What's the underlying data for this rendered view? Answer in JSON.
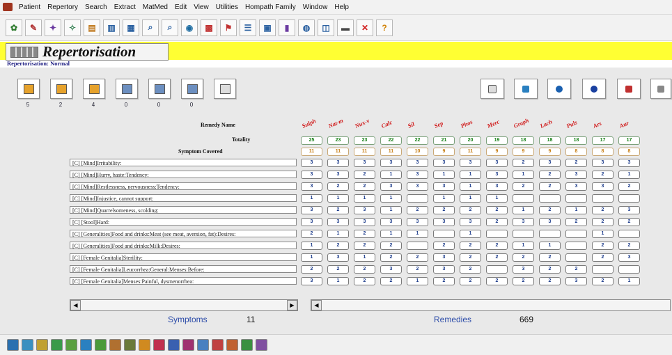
{
  "menu": [
    "Patient",
    "Repertory",
    "Search",
    "Extract",
    "MatMed",
    "Edit",
    "View",
    "Utilities",
    "Hompath Family",
    "Window",
    "Help"
  ],
  "title": "Repertorisation",
  "subtitle": "Repertorisation: Normal",
  "tool_counts": [
    "5",
    "2",
    "4",
    "0",
    "0",
    "0"
  ],
  "table": {
    "remedy_name_label": "Remedy Name",
    "totality_label": "Totality",
    "symptom_covered_label": "Symptom Covered",
    "remedies": [
      "Sulph",
      "Nat-m",
      "Nux-v",
      "Calc",
      "Sil",
      "Sep",
      "Phos",
      "Merc",
      "Graph",
      "Lach",
      "Puls",
      "Ars",
      "Aur"
    ],
    "totality": [
      "25",
      "23",
      "23",
      "22",
      "22",
      "21",
      "20",
      "19",
      "18",
      "18",
      "18",
      "17",
      "17"
    ],
    "covered": [
      "11",
      "11",
      "11",
      "11",
      "10",
      "9",
      "11",
      "9",
      "9",
      "9",
      "8",
      "8",
      "8"
    ],
    "rows": [
      {
        "symptom": "[C] [Mind]Irritability:",
        "scores": [
          "3",
          "3",
          "3",
          "3",
          "3",
          "3",
          "3",
          "3",
          "2",
          "3",
          "2",
          "3",
          "3"
        ]
      },
      {
        "symptom": "[C] [Mind]Hurry, haste:Tendency:",
        "scores": [
          "3",
          "3",
          "2",
          "1",
          "3",
          "1",
          "1",
          "3",
          "1",
          "2",
          "3",
          "2",
          "1"
        ]
      },
      {
        "symptom": "[C] [Mind]Restlessness, nervousness:Tendency:",
        "scores": [
          "3",
          "2",
          "2",
          "3",
          "3",
          "3",
          "1",
          "3",
          "2",
          "2",
          "3",
          "3",
          "2"
        ]
      },
      {
        "symptom": "[C] [Mind]Injustice, cannot support:",
        "scores": [
          "1",
          "1",
          "1",
          "1",
          "",
          "1",
          "1",
          "1",
          "",
          "",
          "",
          "",
          ""
        ]
      },
      {
        "symptom": "[C] [Mind]Quarrelsomeness, scolding:",
        "scores": [
          "3",
          "2",
          "3",
          "1",
          "2",
          "2",
          "2",
          "2",
          "1",
          "2",
          "1",
          "2",
          "3"
        ]
      },
      {
        "symptom": "[C] [Stool]Hard:",
        "scores": [
          "3",
          "3",
          "3",
          "3",
          "3",
          "3",
          "3",
          "2",
          "3",
          "3",
          "2",
          "2",
          "2"
        ]
      },
      {
        "symptom": "[C] [Generalities]Food and drinks:Meat (see meat, aversion, fat):Desires:",
        "scores": [
          "2",
          "1",
          "2",
          "1",
          "1",
          "",
          "1",
          "",
          "",
          "",
          "",
          "1",
          ""
        ]
      },
      {
        "symptom": "[C] [Generalities]Food and drinks:Milk:Desires:",
        "scores": [
          "1",
          "2",
          "2",
          "2",
          "",
          "2",
          "2",
          "2",
          "1",
          "1",
          "",
          "2",
          "2"
        ]
      },
      {
        "symptom": "[C] [Female Genitalia]Sterility:",
        "scores": [
          "1",
          "3",
          "1",
          "2",
          "2",
          "3",
          "2",
          "2",
          "2",
          "2",
          "",
          "2",
          "3"
        ]
      },
      {
        "symptom": "[C] [Female Genitalia]Leucorrhea:General:Menses:Before:",
        "scores": [
          "2",
          "2",
          "2",
          "3",
          "2",
          "3",
          "2",
          "",
          "3",
          "2",
          "2",
          "",
          ""
        ]
      },
      {
        "symptom": "[C] [Female Genitalia]Menses:Painful, dysmenorrhea:",
        "scores": [
          "3",
          "1",
          "2",
          "2",
          "1",
          "2",
          "2",
          "2",
          "2",
          "2",
          "3",
          "2",
          "1"
        ]
      }
    ]
  },
  "summary": {
    "symptoms_label": "Symptoms",
    "symptoms_count": "11",
    "remedies_label": "Remedies",
    "remedies_count": "669"
  },
  "colors": {
    "title_band": "#ffff33",
    "remedy_text": "#d01818",
    "totality": "#158015",
    "covered": "#c77d12",
    "score": "#1a3a8a",
    "summary_label": "#2a4aa8"
  }
}
